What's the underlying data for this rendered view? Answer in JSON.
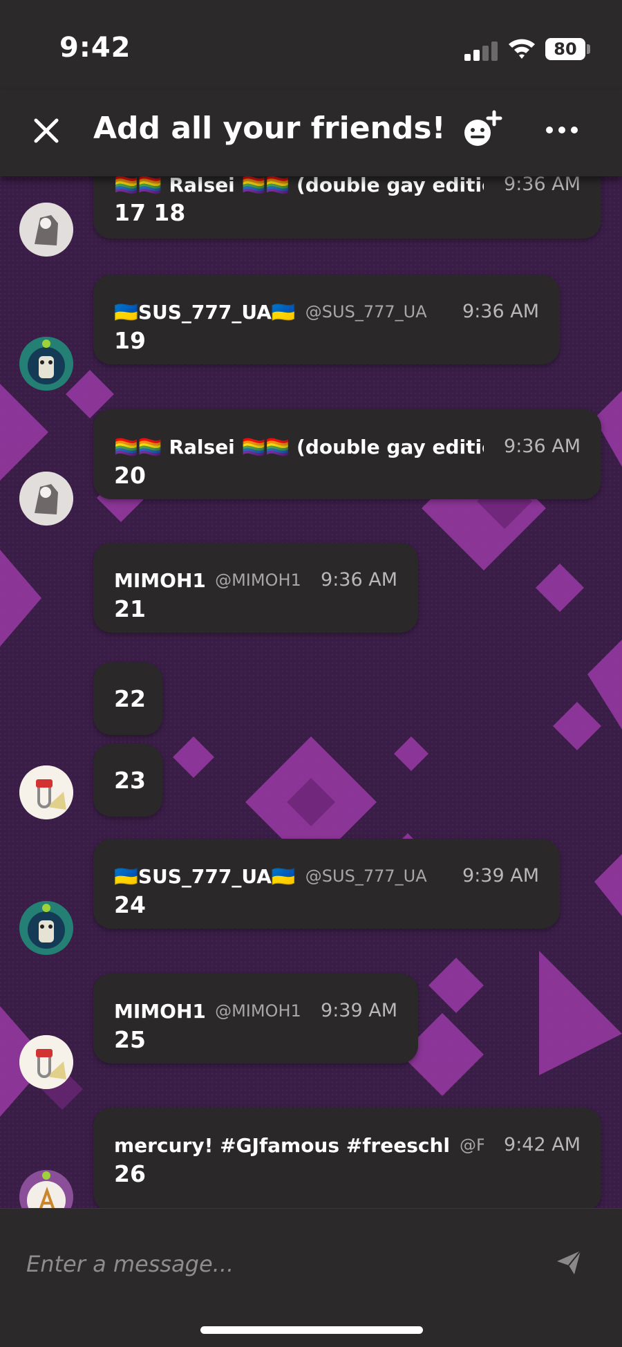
{
  "status_bar": {
    "time": "9:42",
    "battery": "80"
  },
  "header": {
    "title": "Add all your friends!"
  },
  "messages": [
    {
      "author": "🏳️‍🌈🏳️‍🌈 Ralsei 🏳️‍🌈🏳️‍🌈 (double gay editio",
      "handle": "",
      "time": "9:36 AM",
      "text": "17 18",
      "avatar": "ralsei-avatar"
    },
    {
      "author": "🇺🇦SUS_777_UA🇺🇦",
      "handle": "@SUS_777_UA",
      "time": "9:36 AM",
      "text": "19",
      "avatar": "sus-avatar"
    },
    {
      "author": "🏳️‍🌈🏳️‍🌈 Ralsei 🏳️‍🌈🏳️‍🌈 (double gay editio",
      "handle": "",
      "time": "9:36 AM",
      "text": "20",
      "avatar": "ralsei-avatar"
    },
    {
      "author": "MIMOH1",
      "handle": "@MIMOH1",
      "time": "9:36 AM",
      "text": "21",
      "avatar": ""
    },
    {
      "author": "",
      "handle": "",
      "time": "",
      "text": "22",
      "avatar": ""
    },
    {
      "author": "",
      "handle": "",
      "time": "",
      "text": "23",
      "avatar": "mimoh-avatar"
    },
    {
      "author": "🇺🇦SUS_777_UA🇺🇦",
      "handle": "@SUS_777_UA",
      "time": "9:39 AM",
      "text": "24",
      "avatar": "sus-avatar"
    },
    {
      "author": "MIMOH1",
      "handle": "@MIMOH1",
      "time": "9:39 AM",
      "text": "25",
      "avatar": "mimoh-avatar"
    },
    {
      "author": "mercury!  #GJfamous #freeschlep",
      "handle": "@F",
      "time": "9:42 AM",
      "text": "26",
      "avatar": "mercury-avatar"
    }
  ],
  "composer": {
    "placeholder": "Enter a message..."
  },
  "colors": {
    "bubble": "#2a2828",
    "background": "#3c1f4a",
    "accent": "#b34ec0"
  },
  "icons": [
    "close-icon",
    "add-member-icon",
    "more-icon",
    "send-icon",
    "wifi-icon",
    "signal-icon",
    "battery-icon"
  ]
}
